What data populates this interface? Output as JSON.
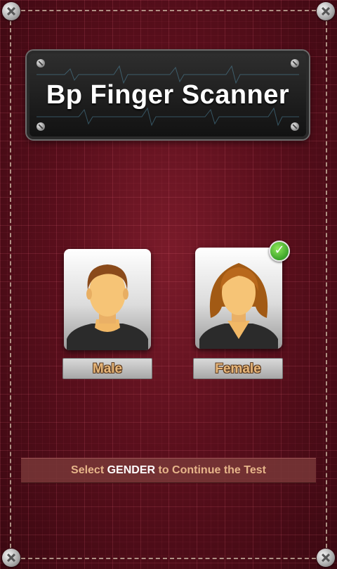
{
  "app": {
    "title": "Bp Finger Scanner"
  },
  "genders": [
    {
      "label": "Male",
      "selected": false,
      "icon": "male-avatar-icon"
    },
    {
      "label": "Female",
      "selected": true,
      "icon": "female-avatar-icon"
    }
  ],
  "selected_badge": {
    "icon": "checkmark-icon",
    "glyph": "✓"
  },
  "instruction": {
    "prefix": "Select ",
    "emphasis": "GENDER",
    "suffix": " to Continue the Test"
  },
  "colors": {
    "background": "#5a0f1c",
    "label_text": "#e8b77a",
    "instruction_text": "#e6b58a",
    "check_green": "#3ca32a"
  }
}
